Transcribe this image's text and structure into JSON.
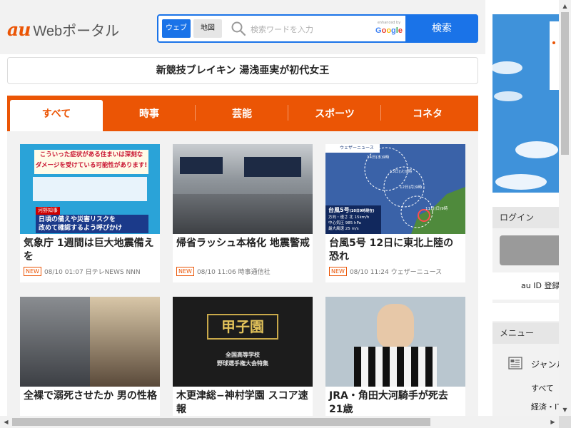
{
  "header": {
    "logo_au": "au",
    "logo_text": "Webポータル",
    "search": {
      "tab_web": "ウェブ",
      "tab_map": "地図",
      "placeholder": "検索ワードを入力",
      "google_enhanced": "enhanced by",
      "google_word": "Google",
      "button": "検索"
    }
  },
  "headline": "新競技ブレイキン 湯浅亜実が初代女王",
  "tabs": [
    {
      "label": "すべて",
      "active": true
    },
    {
      "label": "時事"
    },
    {
      "label": "芸能"
    },
    {
      "label": "スポーツ"
    },
    {
      "label": "コネタ"
    }
  ],
  "articles": [
    {
      "title": "気象庁 1週間は巨大地震備えを",
      "badge": "NEW",
      "time": "08/10 01:07",
      "source": "日テレNEWS NNN",
      "image_texts": [
        "こういった症状がある住まいは深刻な",
        "ダメージを受けている可能性があります!",
        "河野知事",
        "日頃の備えや災害リスクを",
        "改めて確認するよう呼びかけ"
      ]
    },
    {
      "title": "帰省ラッシュ本格化 地震警戒",
      "badge": "NEW",
      "time": "08/10 11:06",
      "source": "時事通信社",
      "image_texts": []
    },
    {
      "title": "台風5号 12日に東北上陸の恐れ",
      "badge": "NEW",
      "time": "08/10 11:24",
      "source": "ウェザーニュース",
      "image_texts": [
        "ウェザーニュース",
        "台風5号",
        "(10日9時現在)",
        "方向・速さ 北 15km/h",
        "中心気圧 985 hPa",
        "最大風速 25 m/s",
        "14日(水)9時",
        "13日(火)9時",
        "12日(月)9時",
        "11日(日)9時"
      ]
    },
    {
      "title": "全裸で溺死させたか 男の性格",
      "image_texts": []
    },
    {
      "title": "木更津総−神村学園 スコア速報",
      "image_texts": [
        "甲子園",
        "全国高等学校",
        "野球選手権大会特集"
      ]
    },
    {
      "title": "JRA・角田大河騎手が死去 21歳",
      "image_texts": []
    }
  ],
  "sidebar": {
    "login_heading": "ログイン",
    "login_link": "au ID 登録",
    "menu_heading": "メニュー",
    "menu_genre": "ジャンル",
    "menu_items": [
      "すべて",
      "経済・IT"
    ]
  },
  "colors": {
    "brand_orange": "#eb5505",
    "search_blue": "#1a73e8",
    "panel_gray": "#f2f2f2"
  },
  "icons": [
    "search-icon",
    "genre-list-icon",
    "scroll-up-arrow-icon",
    "scroll-down-arrow-icon",
    "scroll-left-arrow-icon",
    "scroll-right-arrow-icon"
  ]
}
